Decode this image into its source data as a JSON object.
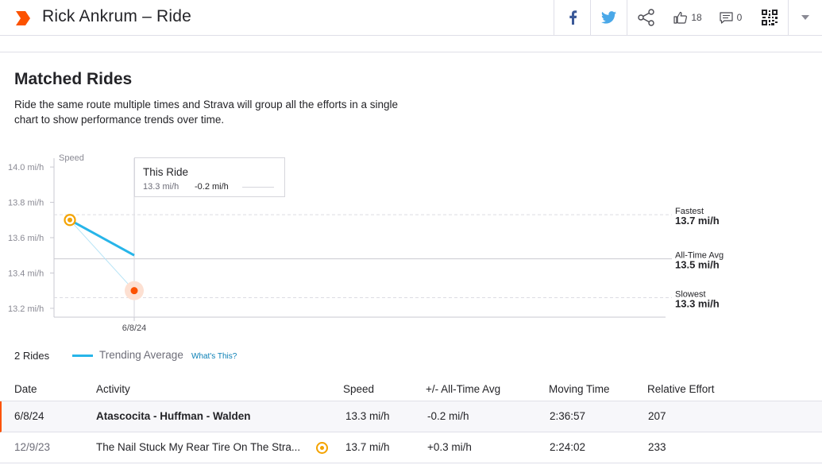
{
  "header": {
    "title": "Rick Ankrum – Ride",
    "kudos_count": "18",
    "comment_count": "0"
  },
  "matched": {
    "title": "Matched Rides",
    "description": "Ride the same route multiple times and Strava will group all the efforts in a single chart to show performance trends over time."
  },
  "chart_data": {
    "type": "line",
    "ylabel": "Speed",
    "yticks": [
      "14.0 mi/h",
      "13.8 mi/h",
      "13.6 mi/h",
      "13.4 mi/h",
      "13.2 mi/h"
    ],
    "ylim": [
      13.15,
      14.05
    ],
    "xtick": "6/8/24",
    "points": [
      {
        "date": "12/9/23",
        "speed": 13.7,
        "kind": "fastest"
      },
      {
        "date": "6/8/24",
        "speed": 13.3,
        "kind": "this-ride"
      }
    ],
    "trending_average": [
      13.7,
      13.5
    ],
    "reference_lines": [
      {
        "label": "Fastest",
        "value": "13.7 mi/h",
        "y": 13.73
      },
      {
        "label": "All-Time Avg",
        "value": "13.5 mi/h",
        "y": 13.48
      },
      {
        "label": "Slowest",
        "value": "13.3 mi/h",
        "y": 13.26
      }
    ]
  },
  "tooltip": {
    "title": "This Ride",
    "speed": "13.3 mi/h",
    "diff": "-0.2 mi/h"
  },
  "legend": {
    "rides": "2 Rides",
    "trend_label": "Trending Average",
    "whats_this": "What's This?"
  },
  "table": {
    "headers": [
      "Date",
      "Activity",
      "Speed",
      "+/- All-Time Avg",
      "Moving Time",
      "Relative Effort"
    ],
    "rows": [
      {
        "date": "6/8/24",
        "activity": "Atascocita - Huffman - Walden",
        "speed": "13.3 mi/h",
        "diff": "-0.2 mi/h",
        "time": "2:36:57",
        "effort": "207"
      },
      {
        "date": "12/9/23",
        "activity": "The Nail Stuck My Rear Tire On The Stra...",
        "speed": "13.7 mi/h",
        "diff": "+0.3 mi/h",
        "time": "2:24:02",
        "effort": "233"
      }
    ]
  },
  "colors": {
    "brand": "#fc5200",
    "trend": "#27b5e9",
    "fastest": "#f4a300",
    "link": "#0a7fb5"
  },
  "icons": [
    "strava-logo",
    "facebook-icon",
    "twitter-icon",
    "share-icon",
    "thumbs-up-icon",
    "comment-icon",
    "qr-code-icon",
    "chevron-down-icon"
  ]
}
